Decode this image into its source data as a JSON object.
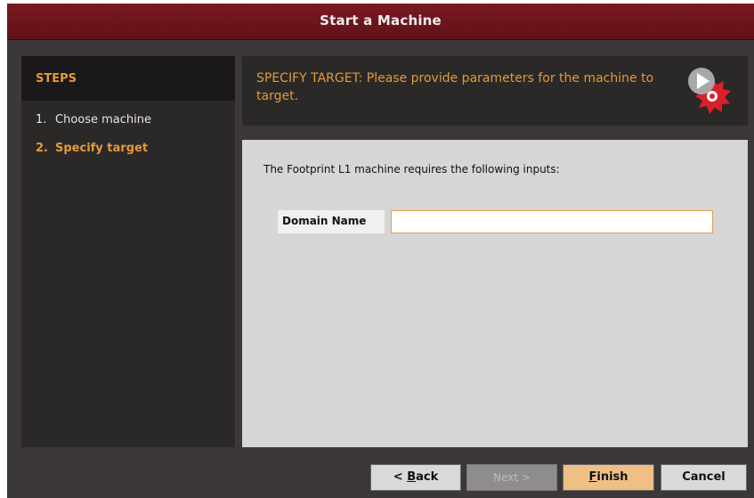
{
  "window": {
    "title": "Start a Machine"
  },
  "steps": {
    "header": "STEPS",
    "items": [
      {
        "num": "1.",
        "label": "Choose machine"
      },
      {
        "num": "2.",
        "label": "Specify target"
      }
    ],
    "active_index": 1
  },
  "banner": {
    "text": "SPECIFY TARGET: Please provide parameters for the machine to target.",
    "logo_icon": "play-gear-logo-icon"
  },
  "content": {
    "intro": "The Footprint L1 machine requires the following inputs:",
    "fields": [
      {
        "label": "Domain Name",
        "value": "",
        "placeholder": ""
      }
    ]
  },
  "buttons": {
    "back": {
      "prefix": "< ",
      "mnemonic": "B",
      "rest": "ack"
    },
    "next": {
      "label": "Next >"
    },
    "finish": {
      "mnemonic": "F",
      "rest": "inish"
    },
    "cancel": {
      "label": "Cancel"
    }
  },
  "colors": {
    "titlebar": "#6a141c",
    "accent_orange": "#e39a3b",
    "panel_dark": "#2b2828",
    "content_bg": "#d6d6d6",
    "finish_button": "#efbf86",
    "input_border": "#e3a24c"
  }
}
